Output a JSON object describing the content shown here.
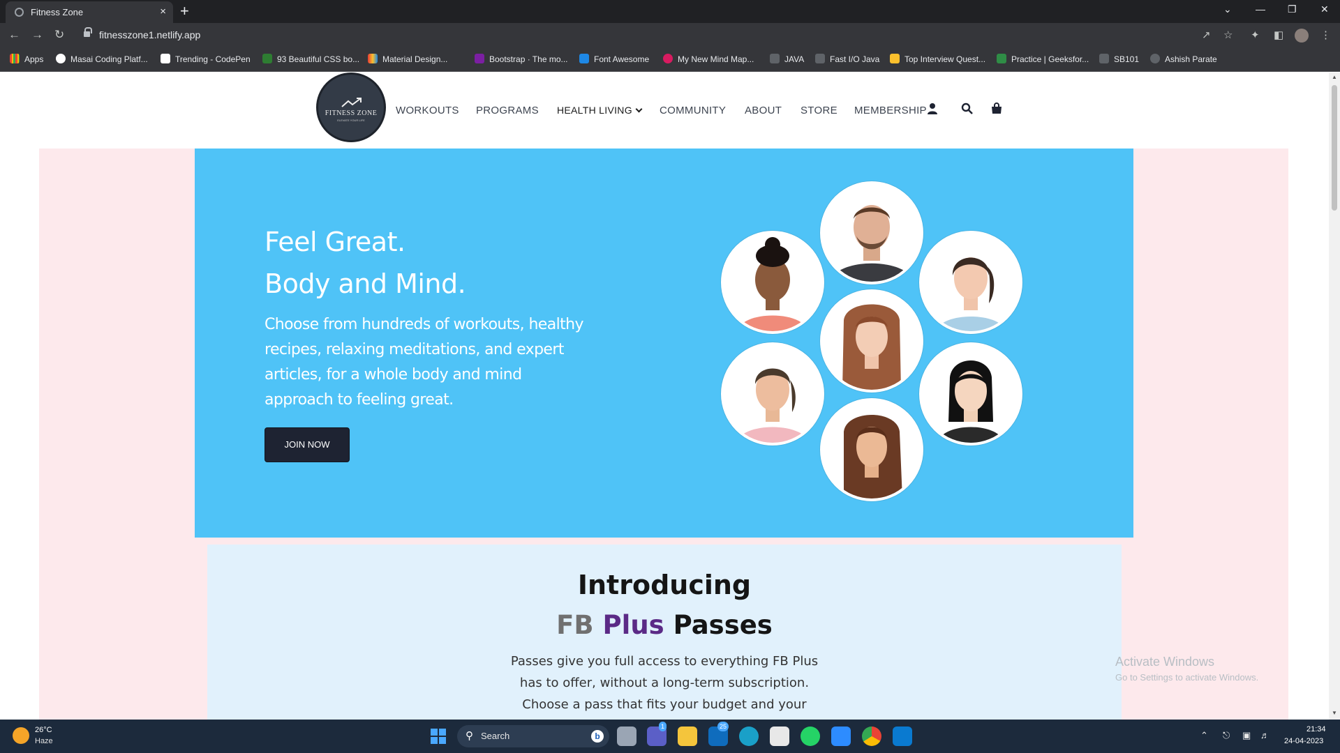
{
  "browser": {
    "tab_title": "Fitness Zone",
    "tab_close": "×",
    "new_tab": "+",
    "url": "fitnesszone1.netlify.app",
    "bookmarks": [
      {
        "label": "Apps",
        "color": "#e8eaed"
      },
      {
        "label": "Masai Coding Platf...",
        "color": "#ffffff"
      },
      {
        "label": "Trending - CodePen",
        "color": "#ffffff"
      },
      {
        "label": "93 Beautiful CSS bo...",
        "color": "#2e7d32"
      },
      {
        "label": "Material Design...",
        "color": "#e53935"
      },
      {
        "label": "Bootstrap · The mo...",
        "color": "#7b1fa2"
      },
      {
        "label": "Font Awesome",
        "color": "#1e88e5"
      },
      {
        "label": "My New Mind Map...",
        "color": "#d81b60"
      },
      {
        "label": "JAVA",
        "color": "#9aa0a6"
      },
      {
        "label": "Fast I/O Java",
        "color": "#9aa0a6"
      },
      {
        "label": "Top Interview Quest...",
        "color": "#fbc02d"
      },
      {
        "label": "Practice | Geeksfor...",
        "color": "#2f8d46"
      },
      {
        "label": "SB101",
        "color": "#9aa0a6"
      },
      {
        "label": "Ashish Parate",
        "color": "#9aa0a6"
      }
    ]
  },
  "site": {
    "logo_name": "FITNESS ZONE",
    "logo_tagline": "ELEVATE YOUR LIFE",
    "nav": [
      "WORKOUTS",
      "PROGRAMS",
      "HEALTH LIVING",
      "COMMUNITY",
      "ABOUT",
      "STORE",
      "MEMBERSHIP"
    ],
    "hero": {
      "heading_1": "Feel Great.",
      "heading_2": "Body and Mind.",
      "text": "Choose from hundreds of workouts, healthy recipes, relaxing meditations, and expert articles, for a whole body and mind approach to feeling great.",
      "button": "JOIN NOW",
      "bg_color": "#4fc3f7"
    },
    "intro": {
      "heading": "Introducing",
      "fb": "FB",
      "plus": "Plus",
      "passes": "Passes",
      "text": "Passes give you full access to everything FB Plus has to offer, without a long-term subscription. Choose a pass that fits your budget and your schedule."
    }
  },
  "watermark": {
    "line1": "Activate Windows",
    "line2": "Go to Settings to activate Windows."
  },
  "taskbar": {
    "weather_temp": "26°C",
    "weather_desc": "Haze",
    "search": "Search",
    "badge_teams": "1",
    "badge_outlook": "25",
    "time": "21:34",
    "date": "24-04-2023"
  }
}
